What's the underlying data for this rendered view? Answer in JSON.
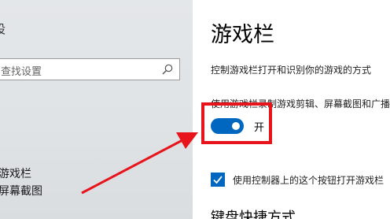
{
  "sidebar": {
    "top_text": "设",
    "search": {
      "placeholder": "查找设置"
    },
    "items": [
      {
        "label": "游戏栏"
      },
      {
        "label": "屏幕截图"
      }
    ]
  },
  "main": {
    "title": "游戏栏",
    "description": "控制游戏栏打开和识别你的游戏的方式",
    "record_setting_label": "使用游戏栏录制游戏剪辑、屏幕截图和广播",
    "toggle": {
      "state_label": "开",
      "on": true
    },
    "checkbox": {
      "label": "使用控制器上的这个按钮打开游戏栏",
      "checked": true
    },
    "section_heading": "键盘快捷方式"
  },
  "colors": {
    "accent": "#0067c0",
    "highlight": "#e8141b",
    "sidebar_bg": "#dfe3e5"
  },
  "icons": [
    "search-icon",
    "checkmark-icon",
    "annotation-arrow"
  ]
}
